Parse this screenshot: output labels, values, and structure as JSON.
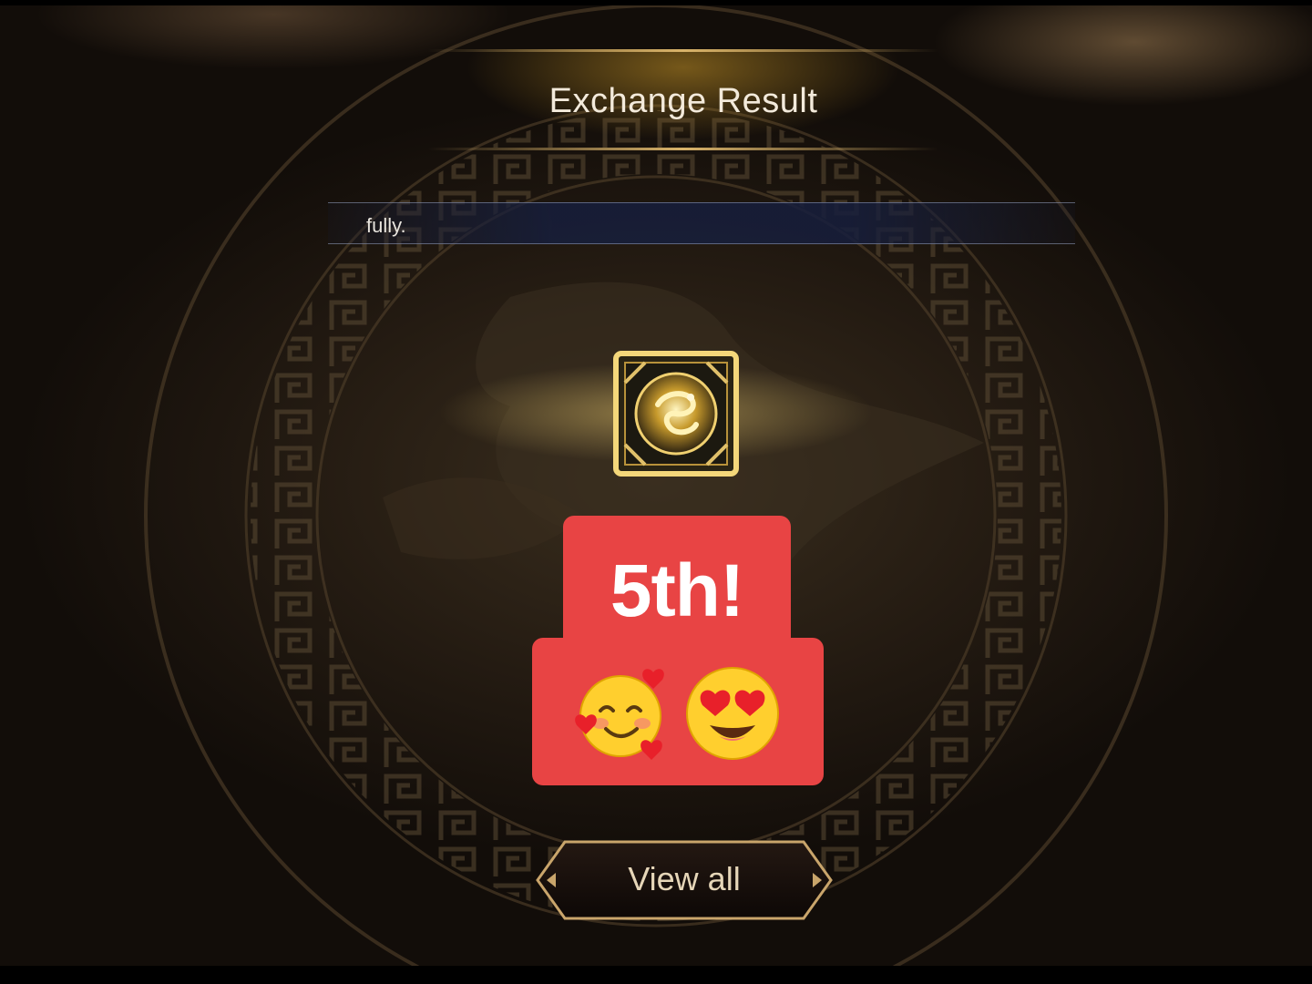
{
  "dialog": {
    "title": "Exchange Result",
    "message": "fully.",
    "item_icon": "golden-dragon-emblem-icon"
  },
  "sticker": {
    "text": "5th!",
    "emojis": [
      "smiling-face-with-hearts",
      "heart-eyes"
    ],
    "color": "#e84444"
  },
  "buttons": {
    "view_all_label": "View all"
  },
  "colors": {
    "accent_gold": "#d9b36a",
    "message_bar": "#161e3c",
    "sticker_red": "#e84444"
  }
}
